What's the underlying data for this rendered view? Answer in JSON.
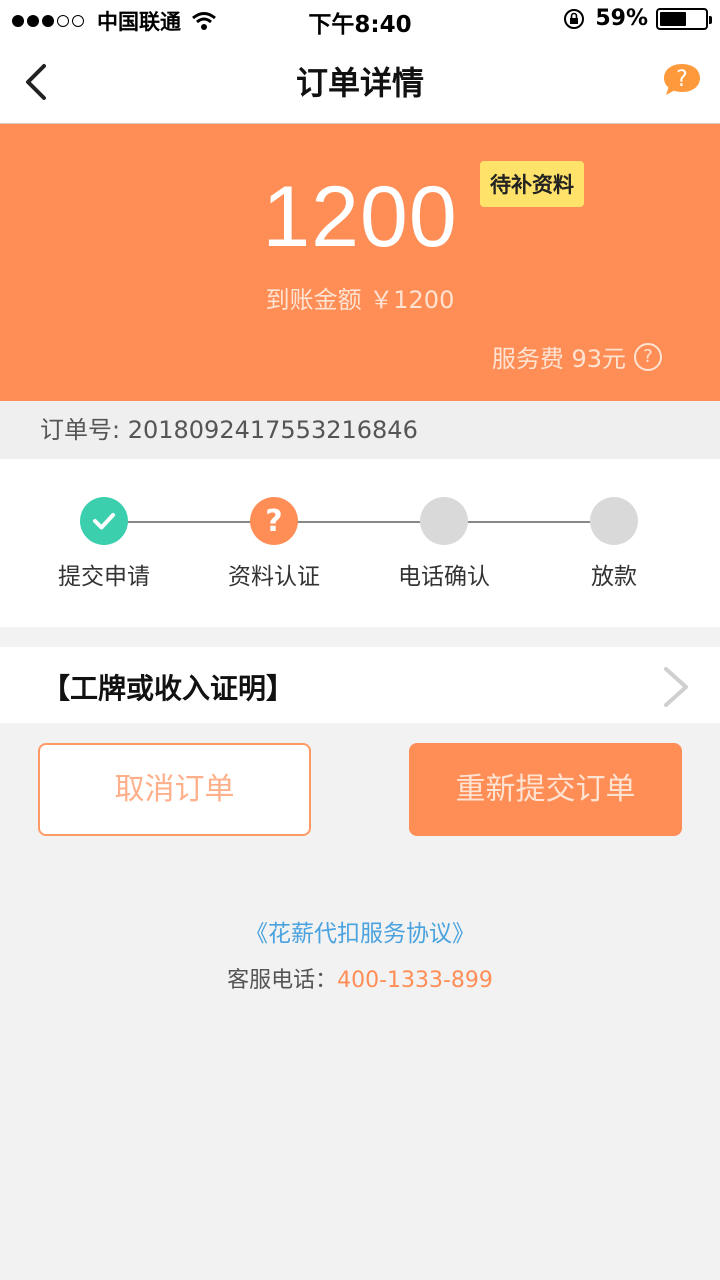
{
  "status_bar": {
    "carrier": "中国联通",
    "time": "下午8:40",
    "battery": "59%",
    "battery_level": 0.59,
    "signal_bars": 3
  },
  "nav": {
    "title": "订单详情",
    "back_icon": "chevron-left-icon",
    "help_icon": "question-icon"
  },
  "hero": {
    "amount": "1200",
    "badge": "待补资料",
    "arrival_text": "到账金额 ￥1200",
    "fee_text": "服务费 93元",
    "fee_help": "?"
  },
  "order": {
    "number_text": "订单号: 2018092417553216846"
  },
  "steps": [
    {
      "label": "提交申请",
      "state": "done",
      "icon": "check-icon",
      "color": "#3ccfae"
    },
    {
      "label": "资料认证",
      "state": "current",
      "icon": "question-icon",
      "color": "#ff8e56"
    },
    {
      "label": "电话确认",
      "state": "pending",
      "icon": "",
      "color": "#d9d9d9"
    },
    {
      "label": "放款",
      "state": "pending",
      "icon": "",
      "color": "#d9d9d9"
    }
  ],
  "document": {
    "label": "【工牌或收入证明】"
  },
  "actions": {
    "cancel_label": "取消订单",
    "resubmit_label": "重新提交订单"
  },
  "footer": {
    "agreement": "《花薪代扣服务协议》",
    "service_label": "客服电话：",
    "service_phone": "400-1333-899"
  },
  "colors": {
    "accent": "#ff8e56",
    "badge": "#ffe26a",
    "success": "#3ccfae",
    "link": "#4aa3df"
  }
}
